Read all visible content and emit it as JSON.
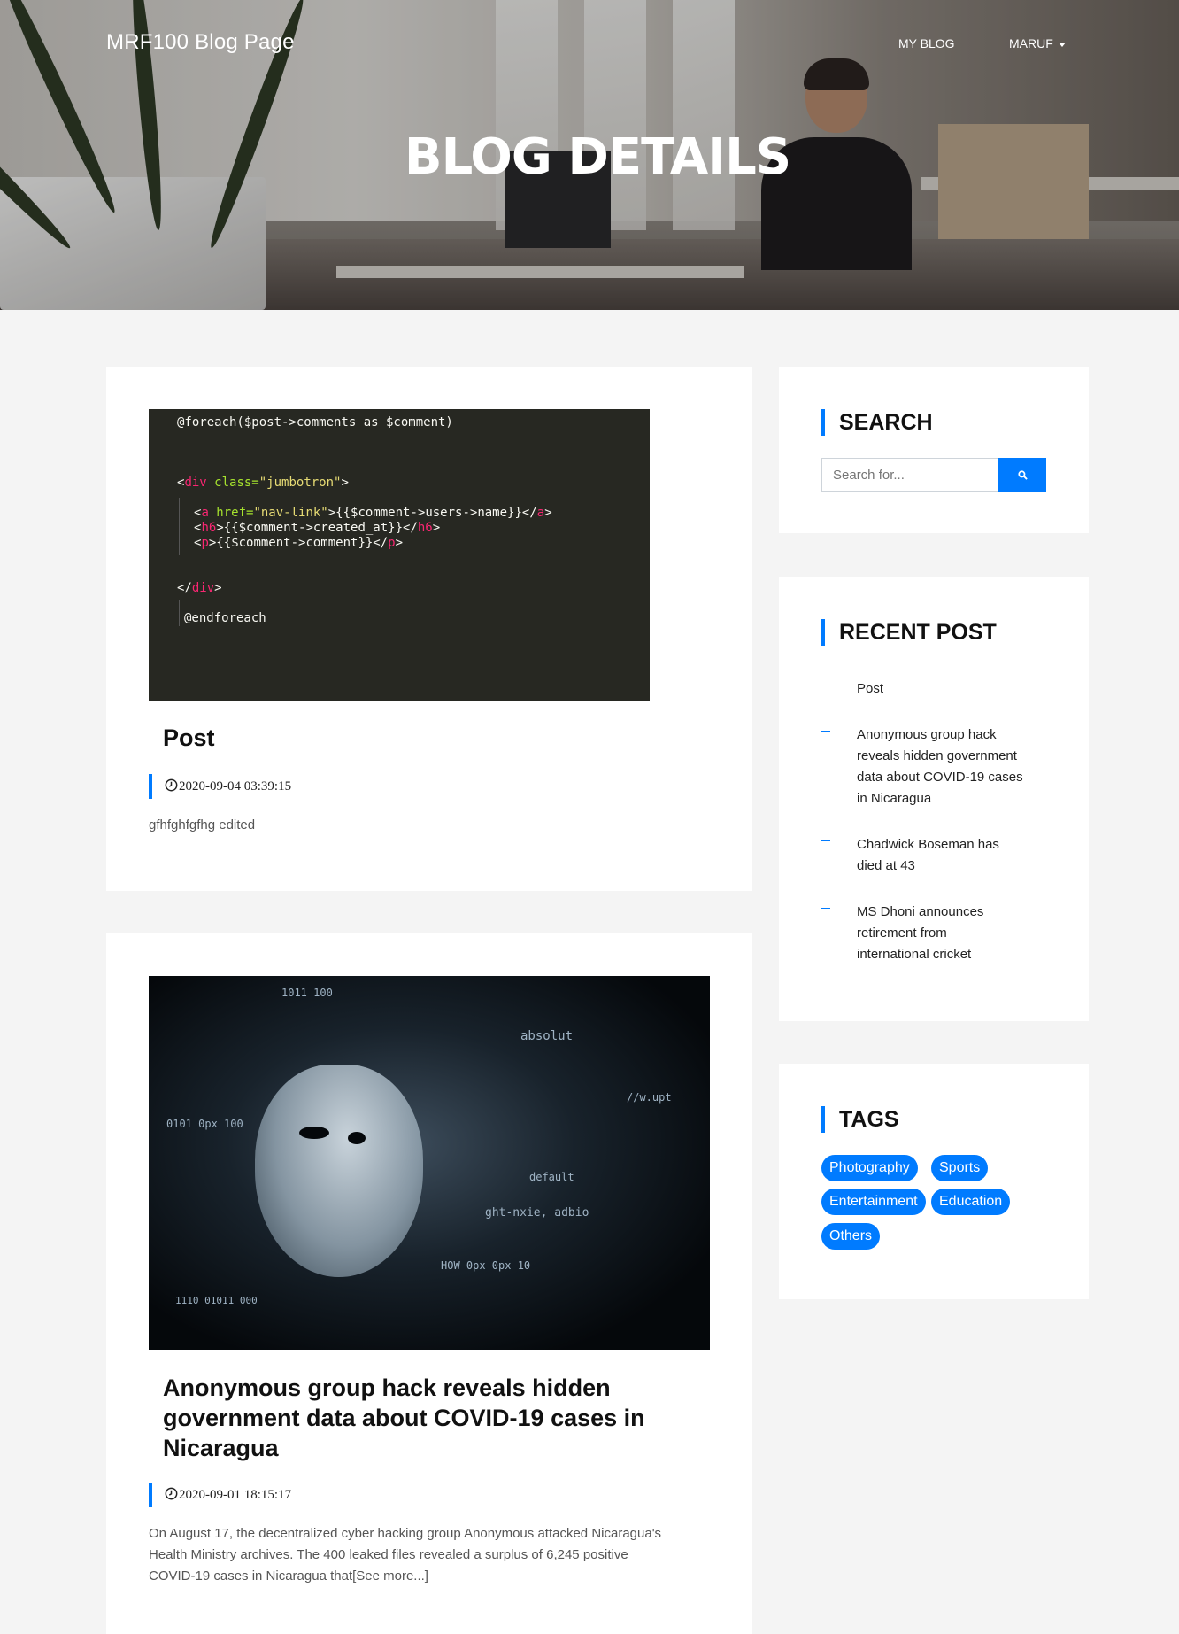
{
  "header": {
    "brand": "MRF100 Blog Page",
    "nav": {
      "my_blog": "MY BLOG",
      "user": "MARUF"
    },
    "hero_title": "BLOG DETAILS"
  },
  "posts": [
    {
      "code_lines": {
        "l1": "@foreach($post->comments as $comment)",
        "l2_open": "<",
        "l2_tag": "div",
        "l2_attr": " class=",
        "l2_val": "\"jumbotron\"",
        "l2_close": ">",
        "l3_open": "<",
        "l3_tag": "a",
        "l3_attr": " href=",
        "l3_val": "\"nav-link\"",
        "l3_rest": ">{{$comment->users->name}}</",
        "l3_endtag": "a",
        "l3_end": ">",
        "l4_open": "<",
        "l4_tag": "h6",
        "l4_rest": ">{{$comment->created_at}}</",
        "l4_endtag": "h6",
        "l4_end": ">",
        "l5_open": "<",
        "l5_tag": "p",
        "l5_rest": ">{{$comment->comment}}</",
        "l5_endtag": "p",
        "l5_end": ">",
        "l6_open": "</",
        "l6_tag": "div",
        "l6_end": ">",
        "l7": "@endforeach"
      },
      "title": "Post",
      "date": "2020-09-04 03:39:15",
      "excerpt": "gfhfghfgfhg edited"
    },
    {
      "image": "anonymous-hacker-mask",
      "title_line1": "Anonymous group hack reveals hidden",
      "title_line2": "government data about COVID-19 cases in",
      "title_line3": "Nicaragua",
      "date": "2020-09-01 18:15:17",
      "excerpt_line1": "On August 17, the decentralized cyber hacking group Anonymous attacked Nicaragua's",
      "excerpt_line2": "Health Ministry archives. The 400 leaked files revealed a surplus of 6,245 positive",
      "excerpt_line3": "COVID-19 cases in Nicaragua that[See more...]"
    }
  ],
  "sidebar": {
    "search": {
      "title": "SEARCH",
      "placeholder": "Search for...",
      "button_icon": "search-icon"
    },
    "recent": {
      "title": "RECENT POST",
      "items": [
        {
          "l1": "Post"
        },
        {
          "l1": "Anonymous group hack",
          "l2": "reveals hidden government",
          "l3": "data about COVID-19 cases",
          "l4": "in Nicaragua"
        },
        {
          "l1": "Chadwick Boseman has",
          "l2": "died at 43"
        },
        {
          "l1": "MS Dhoni announces",
          "l2": "retirement from",
          "l3": "international cricket"
        }
      ]
    },
    "tags": {
      "title": "TAGS",
      "items": [
        "Photography",
        "Sports",
        "Entertainment",
        "Education",
        "Others"
      ]
    }
  },
  "colors": {
    "accent": "#007bff",
    "page_bg": "#f4f4f4",
    "code_bg": "#272822"
  }
}
